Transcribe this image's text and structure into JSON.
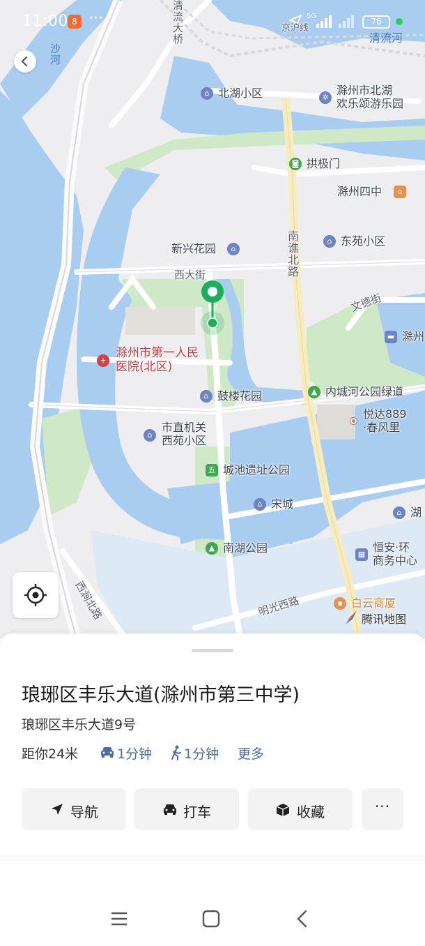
{
  "status_bar": {
    "time": "11:00",
    "app_badge": "8",
    "more": "···",
    "network": "5G",
    "battery": "76"
  },
  "map": {
    "labels": {
      "qingliu_bridge": "清流大桥",
      "sha_river": "沙河",
      "jinghu_line": "京沪线",
      "qingliu_river": "清流河",
      "beihu_community": "北湖小区",
      "beihu_park": "滁州市北湖",
      "beihu_park_2": "欢乐颂游乐园",
      "gongji_gate": "拱极门",
      "chuzhou_no4": "滁州四中",
      "nanqiao_road": "南谯北路",
      "xinxing_garden": "新兴花园",
      "dongyuan_community": "东苑小区",
      "xidajie": "西大街",
      "wende_street": "文德街",
      "chuzhou_short": "滁州",
      "hospital_1": "滁州市第一人民",
      "hospital_2": "医院(北区)",
      "inner_river_park": "内城河公园绿道",
      "gulou_garden": "鼓楼花园",
      "yueda_1": "悦达889",
      "yueda_2": "·春风里",
      "gov_1": "市直机关",
      "gov_2": "西苑小区",
      "city_wall_park": "城池遗址公园",
      "song_city": "宋城",
      "lake_short": "湖",
      "nanhu_park": "南湖公园",
      "hengan_1": "恒安·环",
      "hengan_2": "商务中心",
      "xijian_road": "西涧北路",
      "mingguang_road": "明光西路",
      "baiyun_mall": "白云商厦",
      "brand": "腾讯地图"
    }
  },
  "place": {
    "title": "琅琊区丰乐大道(滁州市第三中学)",
    "address": "琅琊区丰乐大道9号",
    "distance": "距你24米",
    "drive_time": "1分钟",
    "walk_time": "1分钟",
    "more": "更多"
  },
  "actions": {
    "navigate": "导航",
    "taxi": "打车",
    "favorite": "收藏",
    "more": "···"
  },
  "colors": {
    "water": "#a9cdf0",
    "park": "#cfe9c6",
    "land": "#eeeef0",
    "road": "#ffffff",
    "main_road": "#f6ecbf",
    "pin": "#1aaf5d",
    "link": "#4b6ea8"
  }
}
